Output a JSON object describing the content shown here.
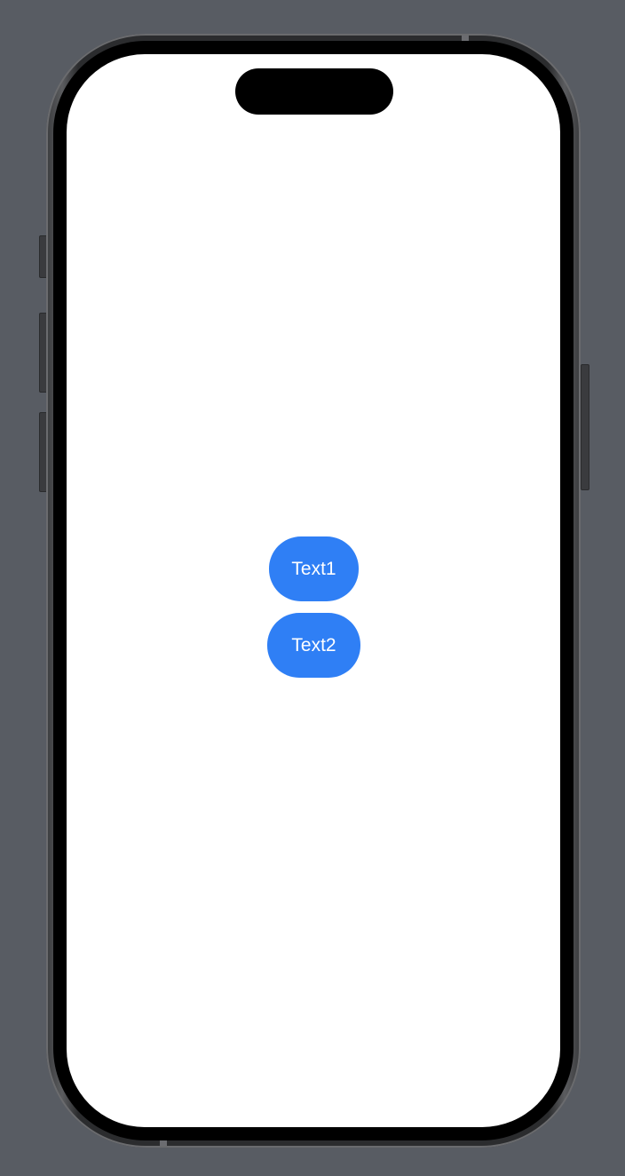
{
  "device": {
    "model": "iPhone",
    "screen_background": "#ffffff",
    "page_background": "#585c63"
  },
  "buttons": [
    {
      "label": "Text1",
      "color": "#2f7ff5",
      "text_color": "#ffffff"
    },
    {
      "label": "Text2",
      "color": "#2f7ff5",
      "text_color": "#ffffff"
    }
  ]
}
